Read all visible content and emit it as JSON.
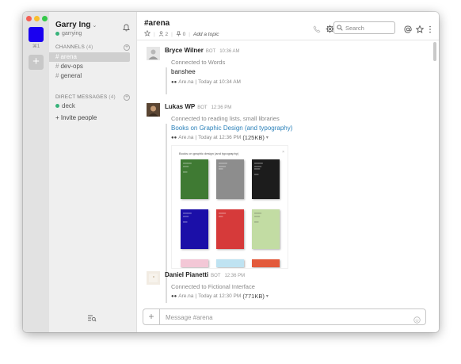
{
  "workspace": {
    "shortcut": "⌘1",
    "add_label": "+",
    "accent_color": "#1a00f0"
  },
  "sidebar": {
    "team_name": "Garry Ing",
    "team_caret": "⌄",
    "username": "garrying",
    "channels_header": "CHANNELS",
    "channels_count": "(4)",
    "channels": [
      {
        "label": "arena",
        "active": true
      },
      {
        "label": "dev-ops",
        "active": false
      },
      {
        "label": "general",
        "active": false
      }
    ],
    "dm_header": "DIRECT MESSAGES",
    "dm_count": "(4)",
    "dms": [
      {
        "label": "deck"
      }
    ],
    "invite_label": "+ Invite people"
  },
  "header": {
    "channel_title": "#arena",
    "members_count": "2",
    "pins_count": "0",
    "topic_placeholder": "Add a topic",
    "search_placeholder": "Search"
  },
  "messages": [
    {
      "author": "Bryce Wilner",
      "bot_tag": "BOT",
      "time": "10:36 AM",
      "pretext": "Connected to Words",
      "text": "banshee",
      "footer_source": "Are.na",
      "footer_time": "Today at 10:34 AM"
    },
    {
      "author": "Lukas WP",
      "bot_tag": "BOT",
      "time": "12:36 PM",
      "pretext": "Connected to reading lists, small libraries",
      "link": "Books on Graphic Design (and typography)",
      "footer_source": "Are.na",
      "footer_time": "Today at 12:36 PM",
      "footer_size": "(125KB)",
      "preview_title": "Books on graphic design (and typography)"
    },
    {
      "author": "Daniel Pianetti",
      "bot_tag": "BOT",
      "time": "12:36 PM",
      "pretext": "Connected to Fictional Interface",
      "footer_source": "Are.na",
      "footer_time": "Today at 12:30 PM",
      "footer_size": "(771KB)"
    }
  ],
  "composer": {
    "placeholder": "Message #arena",
    "plus_label": "+"
  }
}
